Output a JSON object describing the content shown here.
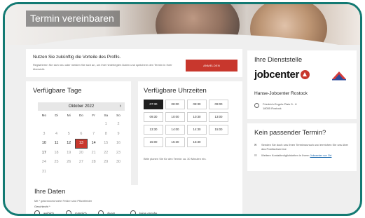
{
  "page": {
    "title": "Termin vereinbaren"
  },
  "promo": {
    "title": "Nutzen Sie zukünftig die Vorteile des Profils.",
    "text": "Registrieren Sie sich neu oder melden Sie sich an, um Ihre hinterlegten Daten und speichern den Termin in Ihrer übersicht.",
    "login_label": "ANMELDEN"
  },
  "days": {
    "heading": "Verfügbare Tage",
    "month": "Oktober 2022",
    "next_icon": "chevron-right-icon",
    "weekdays": [
      "Mo",
      "Di",
      "Mi",
      "Do",
      "Fr",
      "Sa",
      "So"
    ],
    "dates": [
      "",
      "",
      "",
      "",
      "",
      "1",
      "2",
      "3",
      "4",
      "5",
      "6",
      "7",
      "8",
      "9",
      "10",
      "11",
      "12",
      "13",
      "14",
      "15",
      "16",
      "17",
      "18",
      "19",
      "20",
      "21",
      "22",
      "23",
      "24",
      "25",
      "26",
      "27",
      "28",
      "29",
      "30",
      "31",
      "",
      "",
      "",
      "",
      "",
      ""
    ],
    "available": [
      "10",
      "11",
      "12",
      "13",
      "14",
      "17"
    ],
    "selected": "13"
  },
  "times": {
    "heading": "Verfügbare Uhrzeiten",
    "slots": [
      "07:30",
      "08:00",
      "08:30",
      "09:00",
      "09:30",
      "10:00",
      "10:30",
      "13:00",
      "13:30",
      "14:00",
      "14:30",
      "15:00",
      "15:00",
      "15:30",
      "15:30",
      ""
    ],
    "selected": "07:30",
    "note": "Bitte planen Sie für den Termin ca. 30 Minuten ein."
  },
  "your_data": {
    "heading": "Ihre Daten",
    "subtitle": "Mit * gekennzeichnete Felder sind Pflichtfelder",
    "salutation_label": "Geschlecht *",
    "options": [
      "weiblich",
      "männlich",
      "divers",
      "keine Angabe"
    ]
  },
  "office": {
    "heading": "Ihre Dienststelle",
    "logo_text": "jobcenter",
    "name": "Hanse-Jobcenter Rostock",
    "address_line1": "Friedrich-Engels-Platz 5 - 8",
    "address_line2": "18055 Rostock"
  },
  "no_appointment": {
    "heading": "Kein passender Termin?",
    "item1": "Senden Sie doch uns Ihren Terminwunsch und erreichen Sie uns über das Postfachservice",
    "item2": "Weitere Kontaktmöglichkeiten in Ihrem ",
    "item2_link": "Jobcenter vor Ort"
  },
  "colors": {
    "frame": "#137a73",
    "accent_red": "#c8372d",
    "selected_time": "#1e1e1e"
  }
}
